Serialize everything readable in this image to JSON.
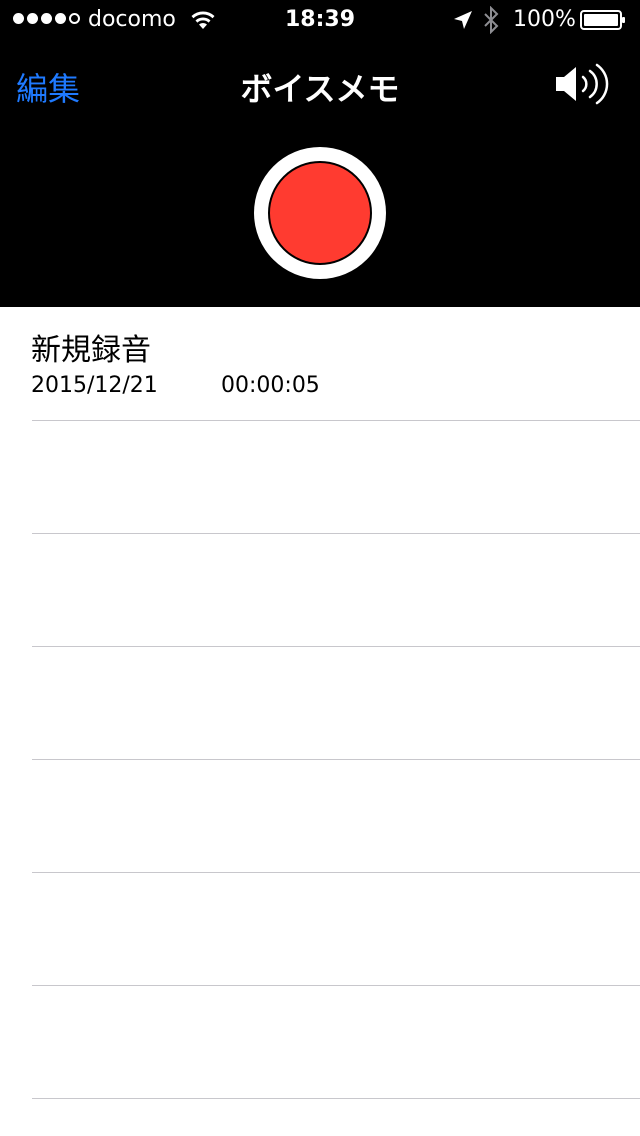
{
  "status_bar": {
    "carrier": "docomo",
    "time": "18:39",
    "battery_percent": "100%",
    "signal_bars_filled": 4,
    "signal_bars_total": 5
  },
  "nav": {
    "edit_label": "編集",
    "title": "ボイスメモ"
  },
  "recordings": [
    {
      "title": "新規録音",
      "date": "2015/12/21",
      "duration": "00:00:05"
    }
  ],
  "colors": {
    "accent": "#1f7aff",
    "record": "#ff3b30",
    "separator": "#c8c7cc"
  }
}
